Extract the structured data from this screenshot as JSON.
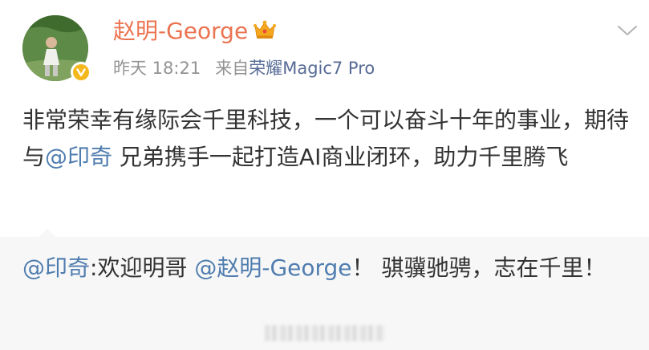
{
  "post": {
    "username": "赵明-George",
    "time": "昨天 18:21",
    "source_prefix": "来自",
    "source_client": "荣耀Magic7 Pro",
    "content_part1": "非常荣幸有缘际会千里科技，一个可以奋斗十年的事业，期待与",
    "content_mention": "@印奇",
    "content_part2": " 兄弟携手一起打造AI商业闭环，助力千里腾飞"
  },
  "repost": {
    "author": "@印奇",
    "text1": ":欢迎明哥 ",
    "mention": "@赵明-George",
    "text2": "！ 骐骥驰骋，志在千里！"
  },
  "icons": {
    "crown": "crown-icon",
    "verified": "verified-badge-icon",
    "menu": "chevron-down-icon"
  },
  "colors": {
    "username": "#eb7350",
    "link": "#507daf",
    "meta": "#939393",
    "repost_bg": "#f7f7f7"
  }
}
